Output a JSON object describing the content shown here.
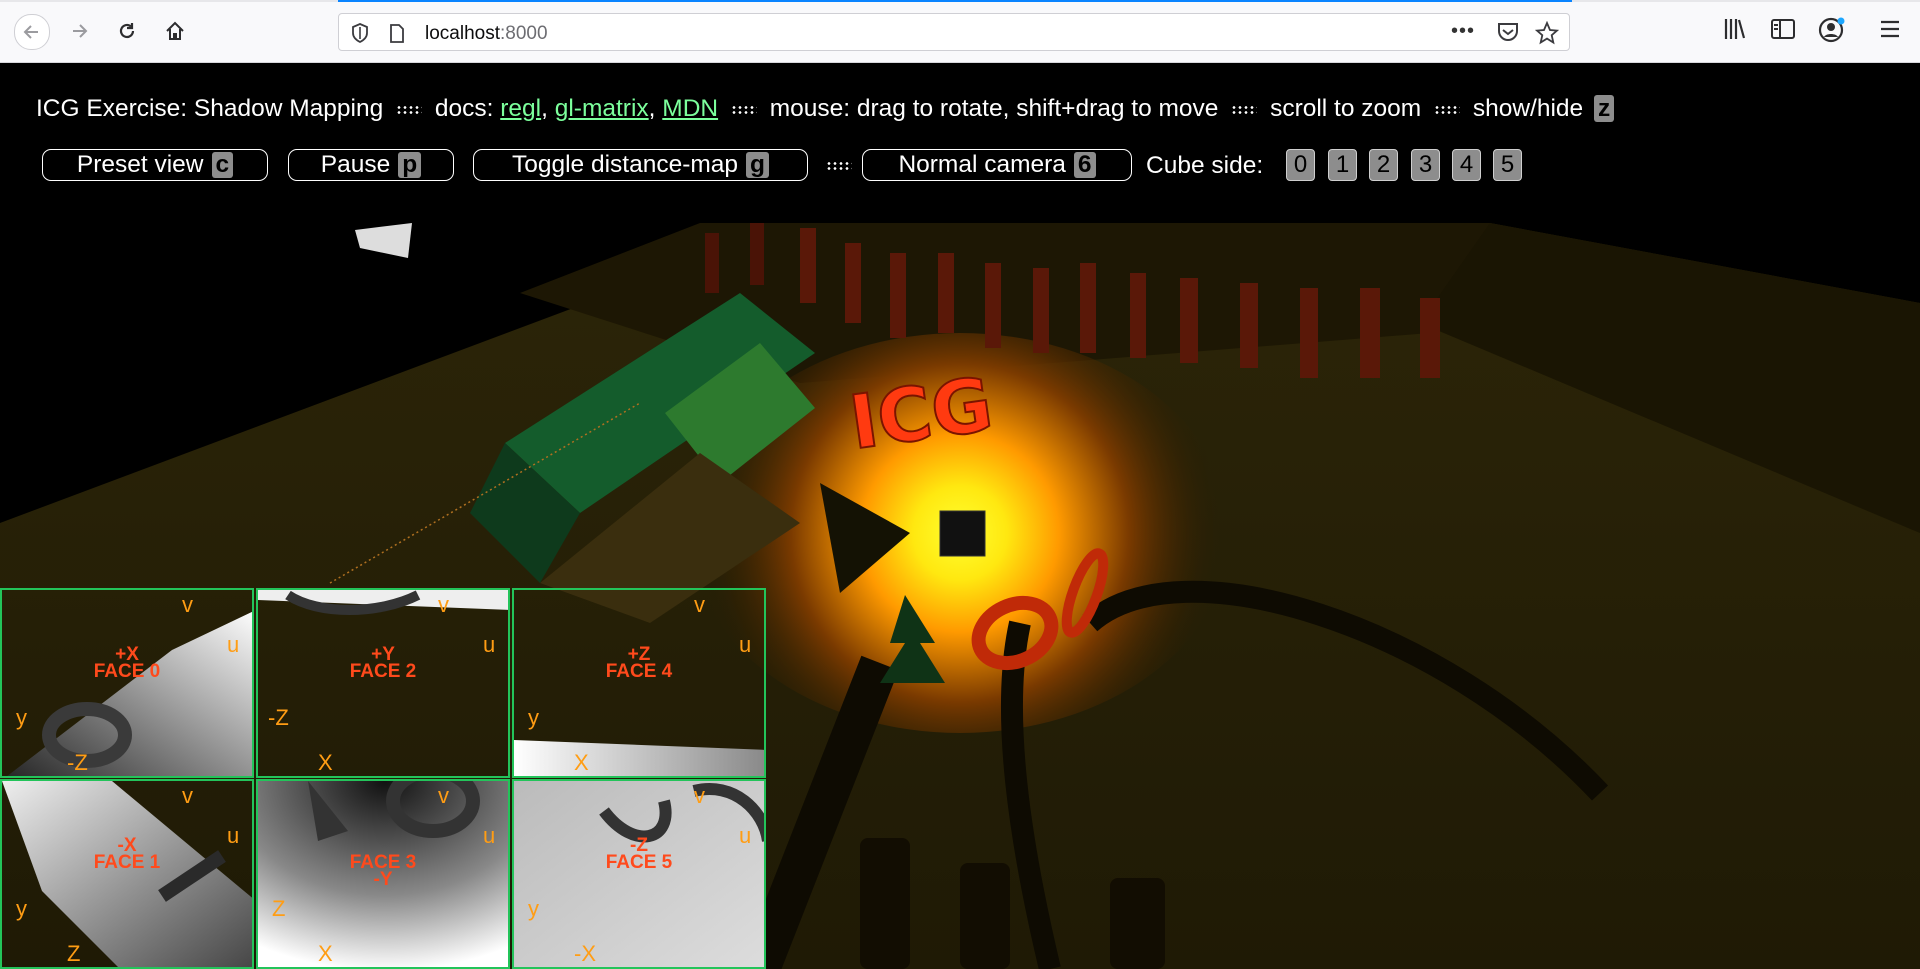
{
  "browser": {
    "url_host": "localhost",
    "url_port": ":8000",
    "icons": [
      "back-arrow-icon",
      "forward-arrow-icon",
      "reload-icon",
      "home-icon",
      "shield-icon",
      "page-icon",
      "more-icon",
      "pocket-icon",
      "star-icon",
      "library-icon",
      "sidebar-icon",
      "account-icon",
      "menu-icon"
    ]
  },
  "header": {
    "title": "ICG Exercise: Shadow Mapping",
    "docs_label": "docs:",
    "links": [
      "regl",
      "gl-matrix",
      "MDN"
    ],
    "mouse_text": "mouse: drag to rotate, shift+drag to move",
    "scroll_text": "scroll to zoom",
    "showhide_text": "show/hide",
    "showhide_key": "z"
  },
  "controls": {
    "preset": {
      "label": "Preset view",
      "key": "c"
    },
    "pause": {
      "label": "Pause",
      "key": "p"
    },
    "toggle": {
      "label": "Toggle distance-map",
      "key": "g"
    },
    "camera": {
      "label": "Normal camera",
      "key": "6"
    },
    "cube_side_label": "Cube side:",
    "cube_sides": [
      "0",
      "1",
      "2",
      "3",
      "4",
      "5"
    ]
  },
  "scene": {
    "sign_text": "ICG"
  },
  "faces": [
    {
      "dir": "+X",
      "name": "FACE 0",
      "sub": "",
      "left_axis": "y",
      "bottom_axis": "-Z"
    },
    {
      "dir": "+Y",
      "name": "FACE 2",
      "sub": "",
      "left_axis": "-Z",
      "bottom_axis": "X"
    },
    {
      "dir": "+Z",
      "name": "FACE 4",
      "sub": "",
      "left_axis": "y",
      "bottom_axis": "X"
    },
    {
      "dir": "-X",
      "name": "FACE 1",
      "sub": "",
      "left_axis": "y",
      "bottom_axis": "Z"
    },
    {
      "dir": "",
      "name": "FACE 3",
      "sub": "-Y",
      "left_axis": "Z",
      "bottom_axis": "X"
    },
    {
      "dir": "-Z",
      "name": "FACE 5",
      "sub": "",
      "left_axis": "y",
      "bottom_axis": "-X"
    }
  ],
  "face_axes": {
    "v": "v",
    "u": "u"
  },
  "colors": {
    "link": "#7CFF9C",
    "face_border": "#23c45a",
    "face_label": "#ff4a1c",
    "axis": "#ff9d14"
  }
}
